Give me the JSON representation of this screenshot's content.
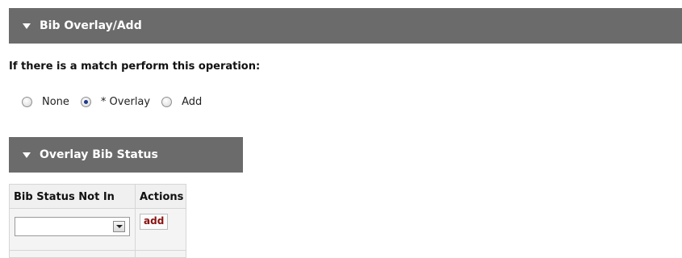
{
  "bib_overlay_section": {
    "title": "Bib Overlay/Add"
  },
  "match_prompt": "If there is a match perform this operation:",
  "match_options": [
    {
      "label": "None",
      "selected": false
    },
    {
      "label": "* Overlay",
      "selected": true
    },
    {
      "label": "Add",
      "selected": false
    }
  ],
  "overlay_status_section": {
    "title": "Overlay Bib Status"
  },
  "status_table": {
    "headers": [
      "Bib Status Not In",
      "Actions"
    ],
    "select_value": "",
    "add_label": "add"
  }
}
